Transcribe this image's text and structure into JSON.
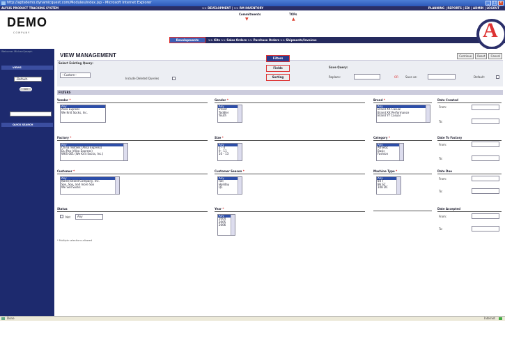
{
  "window": {
    "title": "http://aptsdemo.dynamicquest.com/Modules/index.jsp - Microsoft Internet Explorer"
  },
  "menubar": {
    "left": "ALYSIS PRODUCT TRACKING SYSTEM",
    "center": ">> DEVELOPMENT | >> RM INVENTORY",
    "right": "PLANNING | REPORTS | EDI | ADMIN | LOGOUT"
  },
  "header": {
    "logo": "DEMO",
    "logo_sub": "COMPANY",
    "commitments": "Commitments",
    "tops": "TOPs"
  },
  "nav": {
    "developments": "Developments",
    "items": ">>  Kits  >>  Sales Orders  >>  Purchase Orders  >>  Shipments/Invoices"
  },
  "sidebar": {
    "welcome": "Welcome: Michael Joseph",
    "views_label": "VIEWS",
    "view_select": "-Default-",
    "go": "GO",
    "quick_search_label": "QUICK SEARCH",
    "brand": "APTS"
  },
  "page": {
    "title": "VIEW MANAGEMENT",
    "buttons": [
      "Continue",
      "Reset",
      "Cancel"
    ],
    "select_query_label": "Select Existing Query:",
    "select_query_value": "--Custom--",
    "include_deleted": "Include Deleted Queries",
    "tab_filters": "Filters",
    "tab_fields": "Fields",
    "tab_sorting": "Sorting",
    "save_query_label": "Save Query:",
    "replace_label": "Replace:",
    "or_label": "OR",
    "save_as_label": "Save as:",
    "default_label": "Default:",
    "filters_header": "FILTERS",
    "note": "* Multiple selections allowed"
  },
  "filters": {
    "vendor": {
      "title": "Vendor",
      "options": [
        "Any",
        "Alisa Express",
        "We Knit Socks, Inc."
      ]
    },
    "gender": {
      "title": "Gender",
      "options": [
        "Any",
        "Infant",
        "Toddler",
        "Youth"
      ]
    },
    "brand": {
      "title": "Brand",
      "options": [
        "Any",
        "Brand XX Casual",
        "Brand XX Performance",
        "Brand YY Casual"
      ]
    },
    "factory": {
      "title": "Factory",
      "options": [
        "Any",
        "China Textiles (Alisa Express)",
        "Du Pao (Alisa Express)",
        "WKS 001 (We Knit Socks, Inc.)"
      ]
    },
    "size": {
      "title": "Size",
      "options": [
        "Any",
        "2 - 4",
        "9 - 11",
        "10 - 13"
      ]
    },
    "category": {
      "title": "Category",
      "options": [
        "Any",
        "Athletic",
        "Basic",
        "Fashion"
      ]
    },
    "customer": {
      "title": "Customer",
      "options": [
        "Any",
        "Name Brand Company, Inc.",
        "Sox, Sox, and more Sox",
        "We Sell Socks"
      ]
    },
    "customer_season": {
      "title": "Customer Season",
      "options": [
        "Any",
        "Fall",
        "Holiday",
        "Q1"
      ]
    },
    "machine_type": {
      "title": "Machine Type",
      "options": [
        "Any",
        "84 T",
        "96 SC",
        "108 DC"
      ]
    },
    "status": {
      "title": "Status",
      "not_label": "Not",
      "value": "Any"
    },
    "year": {
      "title": "Year",
      "options": [
        "Any",
        "2004",
        "2005",
        "2006"
      ]
    },
    "date_created": {
      "title": "Date Created",
      "from": "From:",
      "to": "To:"
    },
    "date_to_factory": {
      "title": "Date To Factory",
      "from": "From:",
      "to": "To:"
    },
    "date_due": {
      "title": "Date Due",
      "from": "From:",
      "to": "To:"
    },
    "date_accepted": {
      "title": "Date Accepted",
      "from": "From:",
      "to": "To:"
    }
  },
  "statusbar": {
    "left": "Done",
    "right": "Internet"
  }
}
